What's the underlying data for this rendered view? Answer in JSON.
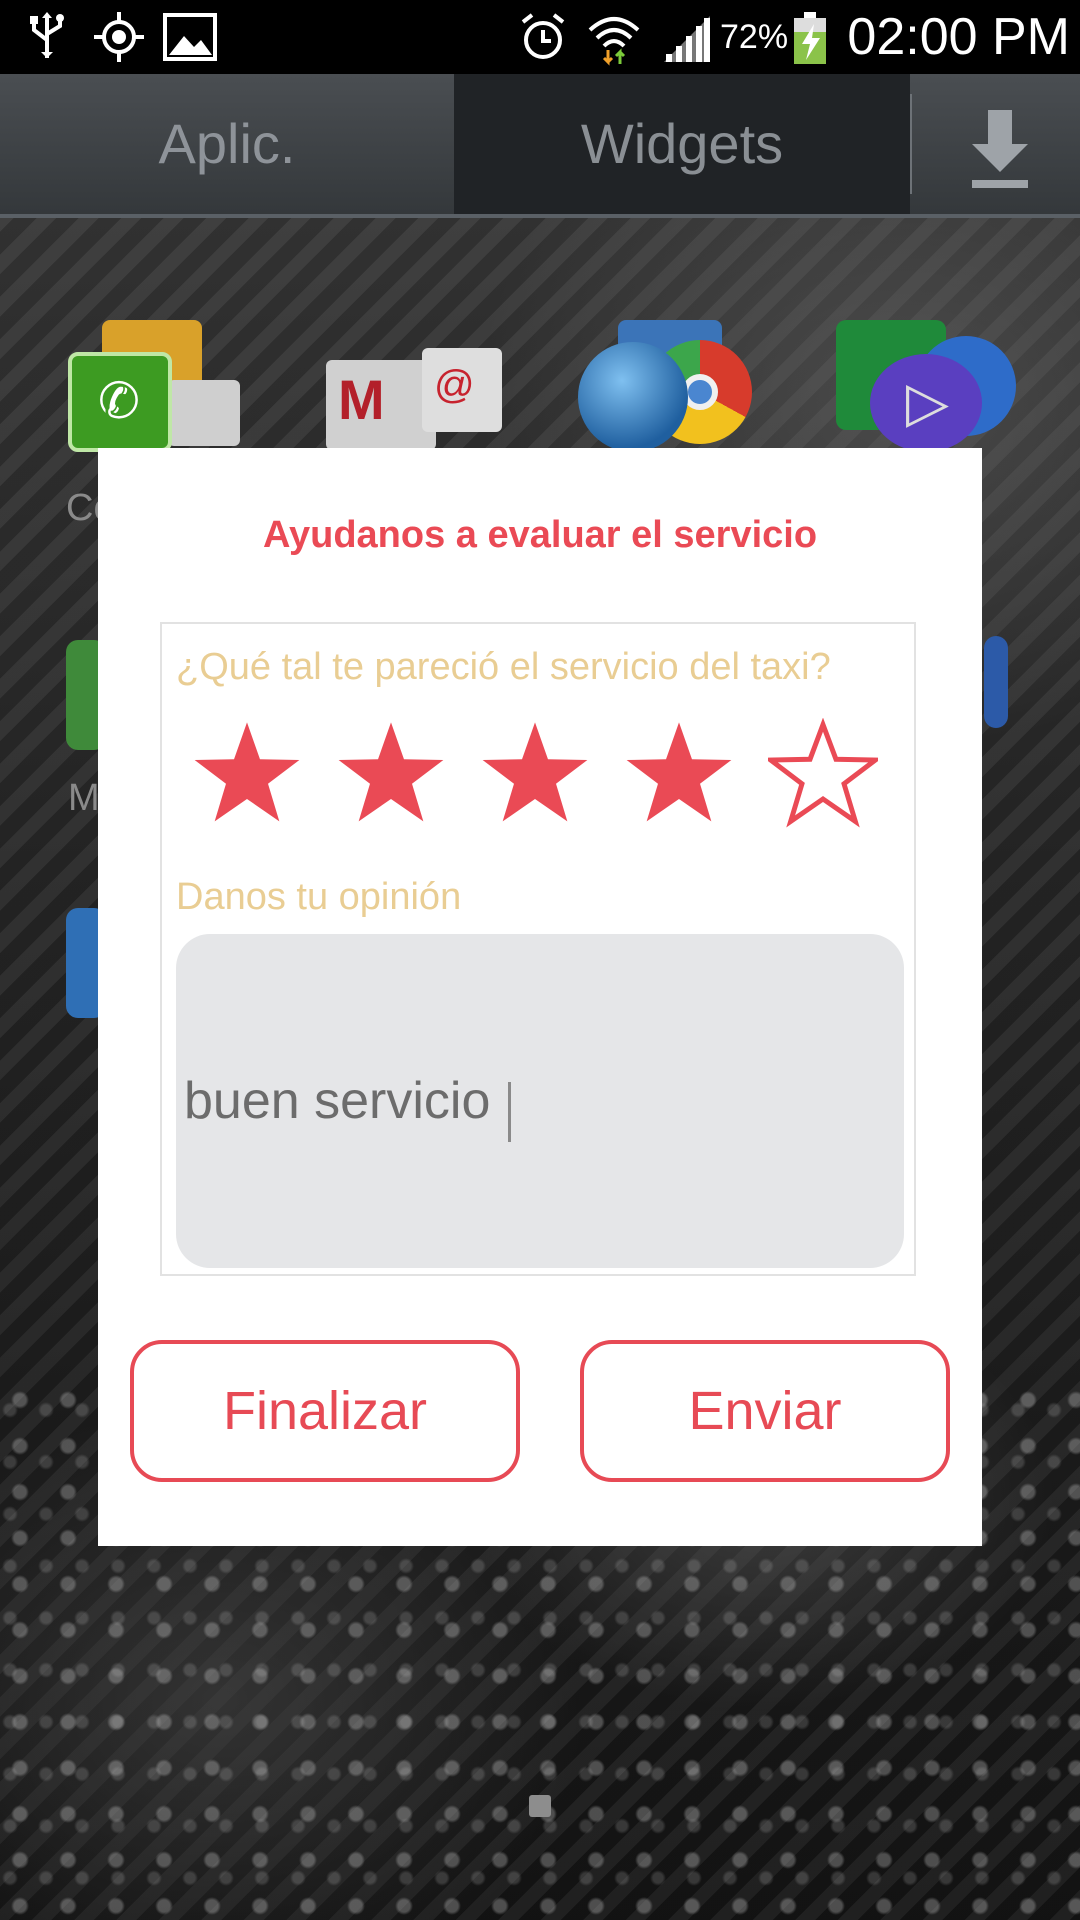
{
  "status_bar": {
    "battery_percent": "72%",
    "time": "02:00 PM"
  },
  "launcher": {
    "tabs": [
      {
        "label": "Aplic."
      },
      {
        "label": "Widgets"
      }
    ],
    "partial_labels": [
      "Co",
      "M"
    ]
  },
  "dialog": {
    "title": "Ayudanos a evaluar el servicio",
    "question": "¿Qué tal te pareció el servicio del taxi?",
    "rating": {
      "value": 4,
      "max": 5
    },
    "opinion_label": "Danos tu opinión",
    "opinion_value": "buen servicio",
    "buttons": {
      "finish": "Finalizar",
      "send": "Enviar"
    }
  },
  "colors": {
    "accent": "#ea4a55",
    "label": "#e9cd93",
    "input_bg": "#e5e6e8"
  }
}
